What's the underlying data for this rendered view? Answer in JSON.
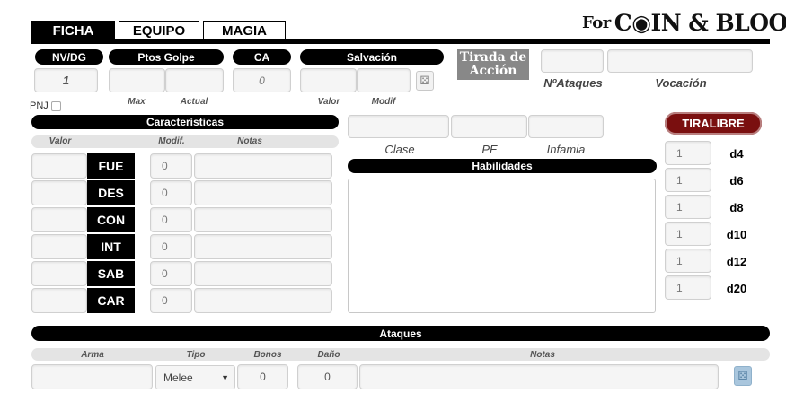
{
  "tabs": [
    {
      "label": "FICHA",
      "active": true
    },
    {
      "label": "EQUIPO",
      "active": false
    },
    {
      "label": "MAGIA",
      "active": false
    }
  ],
  "logo": {
    "prefix": "For",
    "text": "C◉IN & BLOOD"
  },
  "headers": {
    "nvdg": "NV/DG",
    "ptos_golpe": "Ptos Golpe",
    "ca": "CA",
    "salvacion": "Salvación",
    "tirada_accion": "Tirada de Acción"
  },
  "values": {
    "nivel": "1",
    "ca": "0"
  },
  "sublabels": {
    "max": "Max",
    "actual": "Actual",
    "valor": "Valor",
    "modif": "Modif"
  },
  "right_labels": {
    "num_ataques": "NºAtaques",
    "vocacion": "Vocación"
  },
  "pnj_label": "PNJ",
  "caracteristicas": {
    "title": "Características",
    "col_valor": "Valor",
    "col_modif": "Modif.",
    "col_notas": "Notas",
    "stats": [
      {
        "name": "FUE",
        "modif": "0"
      },
      {
        "name": "DES",
        "modif": "0"
      },
      {
        "name": "CON",
        "modif": "0"
      },
      {
        "name": "INT",
        "modif": "0"
      },
      {
        "name": "SAB",
        "modif": "0"
      },
      {
        "name": "CAR",
        "modif": "0"
      }
    ]
  },
  "clase_labels": {
    "clase": "Clase",
    "pe": "PE",
    "infamia": "Infamia"
  },
  "habilidades": {
    "title": "Habilidades"
  },
  "tiralibre": {
    "title": "TIRALIBRE",
    "dice": [
      {
        "count": "1",
        "die": "d4"
      },
      {
        "count": "1",
        "die": "d6"
      },
      {
        "count": "1",
        "die": "d8"
      },
      {
        "count": "1",
        "die": "d10"
      },
      {
        "count": "1",
        "die": "d12"
      },
      {
        "count": "1",
        "die": "d20"
      }
    ]
  },
  "ataques": {
    "title": "Ataques",
    "col_arma": "Arma",
    "col_tipo": "Tipo",
    "col_bonos": "Bonos",
    "col_dano": "Daño",
    "col_notas": "Notas",
    "row": {
      "tipo": "Melee",
      "bonos": "0",
      "dano": "0"
    }
  },
  "colors": {
    "tiralibre_bg": "#7a0f0f",
    "tirada_bg": "#888888"
  }
}
